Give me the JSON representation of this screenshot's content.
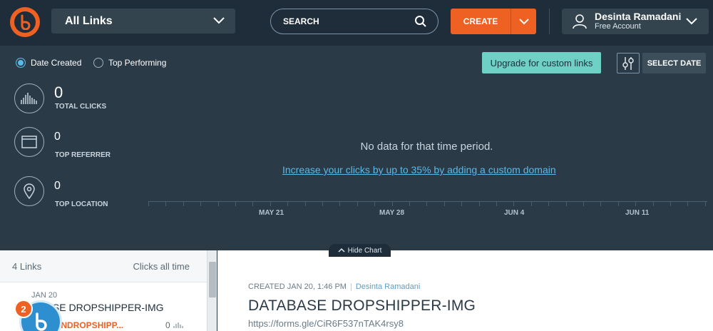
{
  "header": {
    "links_dropdown": "All Links",
    "search_label": "SEARCH",
    "create_label": "CREATE",
    "user_name": "Desinta Ramadani",
    "account_type": "Free Account"
  },
  "controls": {
    "sort_options": [
      {
        "label": "Date Created",
        "selected": true
      },
      {
        "label": "Top Performing",
        "selected": false
      }
    ],
    "upgrade_label": "Upgrade for custom links",
    "select_date_label": "SELECT DATE"
  },
  "stats": [
    {
      "value": "0",
      "label": "TOTAL CLICKS",
      "icon": "bar-chart-icon"
    },
    {
      "value": "0",
      "label": "TOP REFERRER",
      "icon": "browser-window-icon"
    },
    {
      "value": "0",
      "label": "TOP LOCATION",
      "icon": "location-pin-icon"
    }
  ],
  "chart": {
    "empty_message": "No data for that time period.",
    "cta_link": "Increase your clicks by up to 35% by adding a custom domain",
    "x_labels": [
      "MAY 21",
      "MAY 28",
      "JUN 4",
      "JUN 11"
    ],
    "hide_label": "Hide Chart"
  },
  "list": {
    "count_label": "4 Links",
    "sort_label": "Clicks all time",
    "items": [
      {
        "date": "JAN 20",
        "title": "DATABASE DROPSHIPPER-IMG",
        "short": "INDROPSHIPP...",
        "clicks": "0"
      }
    ]
  },
  "notification": {
    "badge": "2"
  },
  "detail": {
    "created": "CREATED JAN 20, 1:46 PM",
    "author": "Desinta Ramadani",
    "title": "DATABASE DROPSHIPPER-IMG",
    "url": "https://forms.gle/CiR6F537nTAK4rsy8"
  },
  "colors": {
    "brand": "#ee6123",
    "accent": "#5bb8e8",
    "upgrade": "#6fd1c5",
    "header_bg": "#1f2d3a",
    "panel_bg": "#2b3a47"
  }
}
